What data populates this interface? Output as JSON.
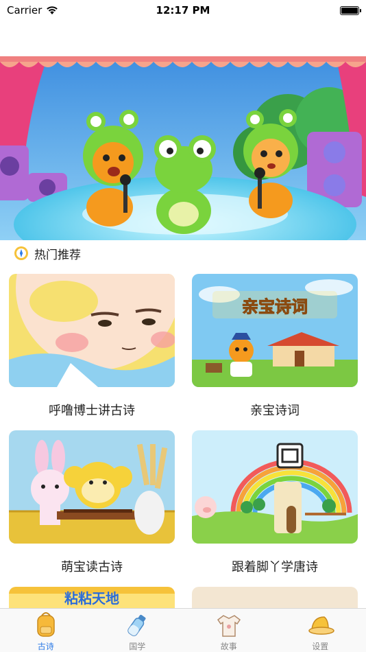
{
  "status_bar": {
    "carrier": "Carrier",
    "time": "12:17 PM"
  },
  "banner": {
    "icon": "banner-image"
  },
  "section": {
    "title": "热门推荐",
    "icon": "compass-icon"
  },
  "cards": [
    {
      "label": "呼噜博士讲古诗"
    },
    {
      "label": "亲宝诗词",
      "image_text": "亲宝诗词"
    },
    {
      "label": "萌宝读古诗"
    },
    {
      "label": "跟着脚丫学唐诗"
    }
  ],
  "partial_cards": [
    {
      "image_text": "粘粘天地"
    },
    {}
  ],
  "tabs": [
    {
      "label": "古诗",
      "icon": "backpack-icon",
      "active": true
    },
    {
      "label": "国学",
      "icon": "bottle-icon",
      "active": false
    },
    {
      "label": "故事",
      "icon": "shirt-icon",
      "active": false
    },
    {
      "label": "设置",
      "icon": "hat-icon",
      "active": false
    }
  ],
  "colors": {
    "active_tab": "#2f7ce6",
    "inactive_tab": "#888888"
  }
}
